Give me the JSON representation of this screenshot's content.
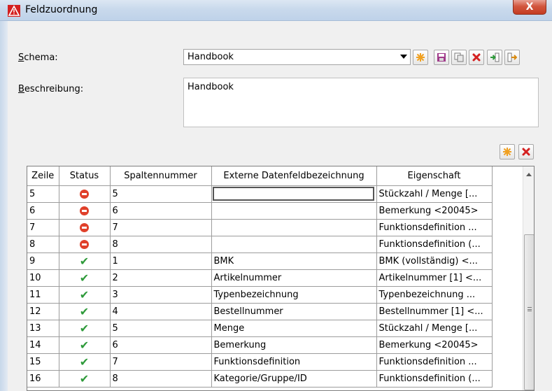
{
  "window": {
    "title": "Feldzuordnung",
    "close_glyph": "X"
  },
  "schema": {
    "label_first": "S",
    "label_rest": "chema:",
    "selected": "Handbook"
  },
  "description": {
    "label_first": "B",
    "label_rest": "eschreibung:",
    "value": "Handbook"
  },
  "toolbar": {
    "icons": [
      "new-icon",
      "save-icon",
      "copy-icon",
      "delete-icon",
      "import-icon",
      "export-icon"
    ]
  },
  "grid_toolbar": {
    "icons": [
      "new-row-icon",
      "delete-row-icon"
    ]
  },
  "colors": {
    "accent_red": "#e0402a",
    "status_ok": "#2e9a3a",
    "delete": "#d42020"
  },
  "table": {
    "headers": [
      "Zeile",
      "Status",
      "Spaltennummer",
      "Externe Datenfeldbezeichnung",
      "Eigenschaft"
    ],
    "rows": [
      {
        "zeile": "5",
        "status": "error",
        "spalte": "5",
        "extern": "",
        "eigenschaft": "Stückzahl / Menge [..."
      },
      {
        "zeile": "6",
        "status": "error",
        "spalte": "6",
        "extern": "",
        "eigenschaft": "Bemerkung <20045>"
      },
      {
        "zeile": "7",
        "status": "error",
        "spalte": "7",
        "extern": "",
        "eigenschaft": "Funktionsdefinition ..."
      },
      {
        "zeile": "8",
        "status": "error",
        "spalte": "8",
        "extern": "",
        "eigenschaft": "Funktionsdefinition (..."
      },
      {
        "zeile": "9",
        "status": "ok",
        "spalte": "1",
        "extern": "BMK",
        "eigenschaft": "BMK (vollständig) <..."
      },
      {
        "zeile": "10",
        "status": "ok",
        "spalte": "2",
        "extern": "Artikelnummer",
        "eigenschaft": "Artikelnummer [1] <..."
      },
      {
        "zeile": "11",
        "status": "ok",
        "spalte": "3",
        "extern": "Typenbezeichnung",
        "eigenschaft": "Typenbezeichnung ..."
      },
      {
        "zeile": "12",
        "status": "ok",
        "spalte": "4",
        "extern": "Bestellnummer",
        "eigenschaft": "Bestellnummer [1] <..."
      },
      {
        "zeile": "13",
        "status": "ok",
        "spalte": "5",
        "extern": "Menge",
        "eigenschaft": "Stückzahl / Menge [..."
      },
      {
        "zeile": "14",
        "status": "ok",
        "spalte": "6",
        "extern": "Bemerkung",
        "eigenschaft": "Bemerkung <20045>"
      },
      {
        "zeile": "15",
        "status": "ok",
        "spalte": "7",
        "extern": "Funktionsdefinition",
        "eigenschaft": "Funktionsdefinition ..."
      },
      {
        "zeile": "16",
        "status": "ok",
        "spalte": "8",
        "extern": "Kategorie/Gruppe/ID",
        "eigenschaft": "Funktionsdefinition (..."
      }
    ]
  }
}
